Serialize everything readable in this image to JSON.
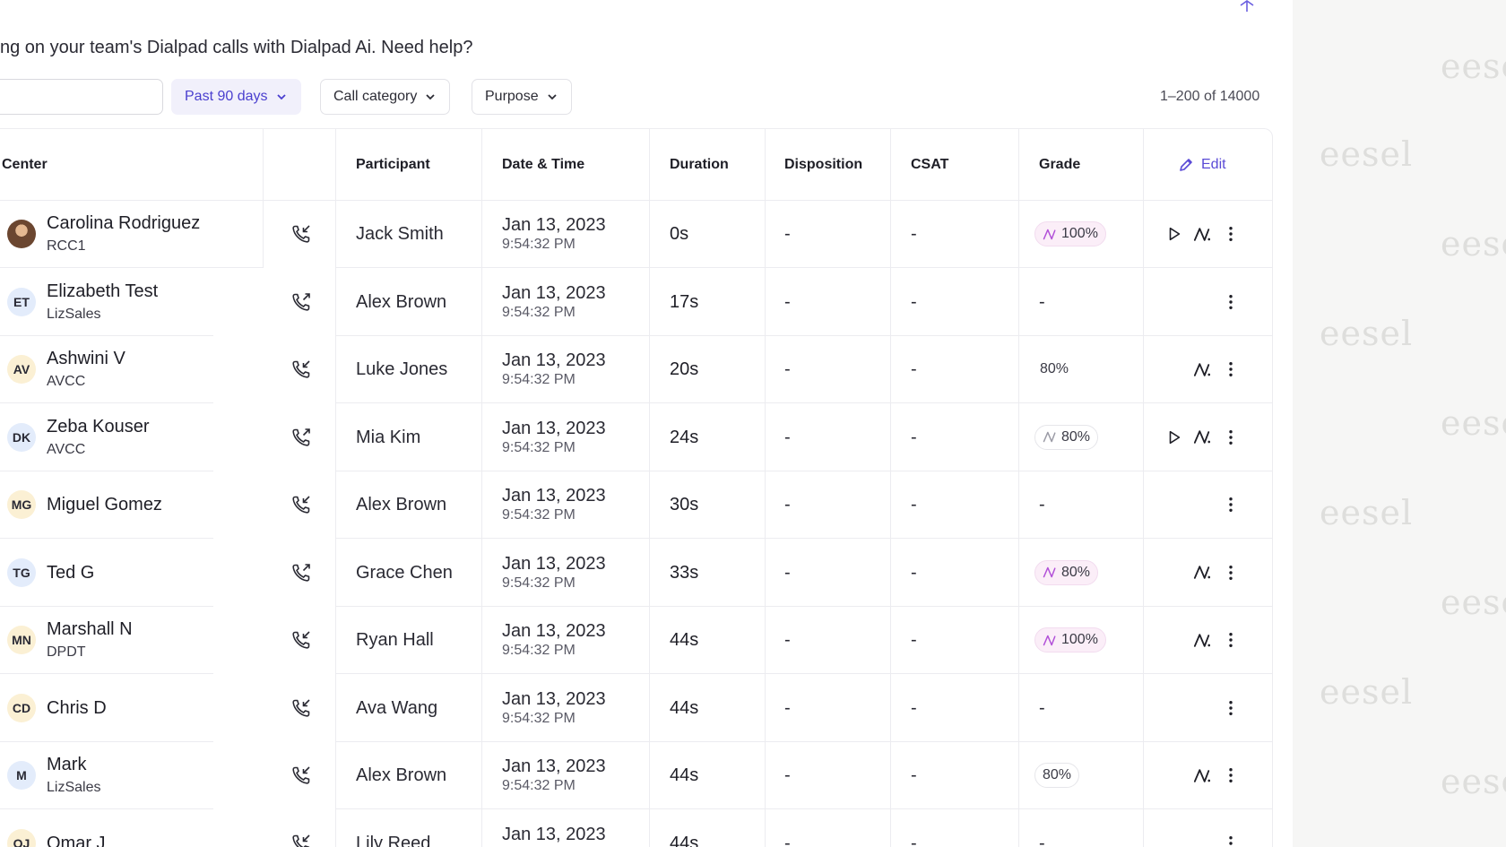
{
  "intro_text": "ng on your team's Dialpad calls with Dialpad Ai. Need help?",
  "search": {
    "placeholder": ""
  },
  "filters": [
    {
      "label": "Past 90 days",
      "active": true
    },
    {
      "label": "Call category",
      "active": false
    },
    {
      "label": "Purpose",
      "active": false
    }
  ],
  "result_count": "1–200 of 14000",
  "table": {
    "headers": {
      "center": "Center",
      "participant": "Participant",
      "datetime": "Date & Time",
      "duration": "Duration",
      "disposition": "Disposition",
      "csat": "CSAT",
      "grade": "Grade",
      "edit": "Edit"
    },
    "rows": [
      {
        "initials": "",
        "avatar": "photo",
        "name": "Carolina Rodriguez",
        "team": "RCC1",
        "direction": "incoming",
        "participant": "Jack Smith",
        "date": "Jan 13, 2023",
        "time": "9:54:32 PM",
        "duration": "0s",
        "disposition": "-",
        "csat": "-",
        "grade": "100%",
        "grade_style": "ai-pink",
        "actions": [
          "play-icon",
          "ai-icon",
          "more-icon"
        ]
      },
      {
        "initials": "ET",
        "avatar": "blue",
        "name": "Elizabeth Test",
        "team": "LizSales",
        "direction": "outgoing",
        "participant": "Alex Brown",
        "date": "Jan 13, 2023",
        "time": "9:54:32 PM",
        "duration": "17s",
        "disposition": "-",
        "csat": "-",
        "grade": "-",
        "grade_style": "dash",
        "actions": [
          "more-icon"
        ]
      },
      {
        "initials": "AV",
        "avatar": "yellow",
        "name": "Ashwini V",
        "team": "AVCC",
        "direction": "incoming",
        "participant": "Luke Jones",
        "date": "Jan 13, 2023",
        "time": "9:54:32 PM",
        "duration": "20s",
        "disposition": "-",
        "csat": "-",
        "grade": "80%",
        "grade_style": "none",
        "actions": [
          "ai-icon",
          "more-icon"
        ]
      },
      {
        "initials": "DK",
        "avatar": "blue",
        "name": "Zeba Kouser",
        "team": "AVCC",
        "direction": "outgoing",
        "participant": "Mia Kim",
        "date": "Jan 13, 2023",
        "time": "9:54:32 PM",
        "duration": "24s",
        "disposition": "-",
        "csat": "-",
        "grade": "80%",
        "grade_style": "ai-plain",
        "actions": [
          "play-icon",
          "ai-icon",
          "more-icon"
        ]
      },
      {
        "initials": "MG",
        "avatar": "yellow",
        "name": "Miguel Gomez",
        "team": "",
        "direction": "incoming",
        "participant": "Alex Brown",
        "date": "Jan 13, 2023",
        "time": "9:54:32 PM",
        "duration": "30s",
        "disposition": "-",
        "csat": "-",
        "grade": "-",
        "grade_style": "dash",
        "actions": [
          "more-icon"
        ]
      },
      {
        "initials": "TG",
        "avatar": "blue",
        "name": "Ted G",
        "team": "",
        "direction": "outgoing",
        "participant": "Grace Chen",
        "date": "Jan 13, 2023",
        "time": "9:54:32 PM",
        "duration": "33s",
        "disposition": "-",
        "csat": "-",
        "grade": "80%",
        "grade_style": "ai-pink",
        "actions": [
          "ai-icon",
          "more-icon"
        ]
      },
      {
        "initials": "MN",
        "avatar": "yellow",
        "name": "Marshall N",
        "team": "DPDT",
        "direction": "incoming",
        "participant": "Ryan Hall",
        "date": "Jan 13, 2023",
        "time": "9:54:32 PM",
        "duration": "44s",
        "disposition": "-",
        "csat": "-",
        "grade": "100%",
        "grade_style": "ai-pink",
        "actions": [
          "ai-icon",
          "more-icon"
        ]
      },
      {
        "initials": "CD",
        "avatar": "yellow",
        "name": "Chris D",
        "team": "",
        "direction": "incoming",
        "participant": "Ava Wang",
        "date": "Jan 13, 2023",
        "time": "9:54:32 PM",
        "duration": "44s",
        "disposition": "-",
        "csat": "-",
        "grade": "-",
        "grade_style": "dash",
        "actions": [
          "more-icon"
        ]
      },
      {
        "initials": "M",
        "avatar": "blue",
        "name": "Mark",
        "team": "LizSales",
        "direction": "incoming",
        "participant": "Alex Brown",
        "date": "Jan 13, 2023",
        "time": "9:54:32 PM",
        "duration": "44s",
        "disposition": "-",
        "csat": "-",
        "grade": "80%",
        "grade_style": "plain",
        "actions": [
          "ai-icon",
          "more-icon"
        ]
      },
      {
        "initials": "OJ",
        "avatar": "yellow",
        "name": "Omar J",
        "team": "",
        "direction": "incoming",
        "participant": "Lily Reed",
        "date": "Jan 13, 2023",
        "time": "",
        "duration": "44s",
        "disposition": "-",
        "csat": "-",
        "grade": "-",
        "grade_style": "dash",
        "actions": [
          "more-icon"
        ]
      }
    ]
  },
  "watermark": "eesel",
  "colors": {
    "accent": "#4a3fcf",
    "ai_pink": "#b14fd8",
    "grid": "#ececf0",
    "side_bg": "#f6f6f5"
  }
}
